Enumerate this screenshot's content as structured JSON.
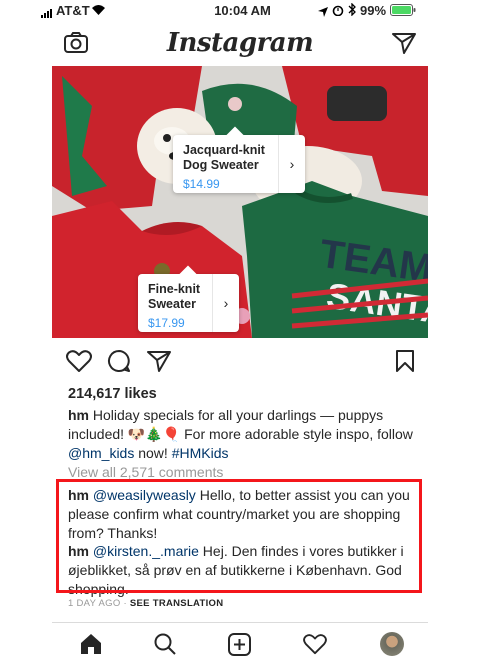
{
  "status_bar": {
    "carrier": "AT&T",
    "time": "10:04 AM",
    "battery": "99%"
  },
  "header": {
    "logo": "Instagram"
  },
  "product_tags": [
    {
      "name_line1": "Jacquard-knit",
      "name_line2": "Dog Sweater",
      "price": "$14.99"
    },
    {
      "name_line1": "Fine-knit",
      "name_line2": "Sweater",
      "price": "$17.99"
    }
  ],
  "photo": {
    "sweater_text_1": "TEAM",
    "sweater_text_2": "SANTA"
  },
  "post": {
    "likes": "214,617 likes",
    "caption_user": "hm",
    "caption_text": "Holiday specials for all your darlings — puppys included! 🐶🎄🎈 For more adorable style inspo, follow",
    "caption_mention": "@hm_kids",
    "caption_middle": " now! ",
    "caption_hashtag": "#HMKids",
    "view_all": "View all 2,571 comments",
    "comments": [
      {
        "user": "hm",
        "mention": "@weasilyweasly",
        "text": " Hello, to better assist you can you please confirm what country/market you are shopping from? Thanks!"
      },
      {
        "user": "hm",
        "mention": "@kirsten._.marie",
        "text": " Hej. Den findes i vores butikker i øjeblikket, så prøv en af butikkerne i København. God shopping."
      }
    ],
    "time_ago": "1 DAY AGO",
    "see_translation": "SEE TRANSLATION"
  },
  "colors": {
    "accent_blue": "#3897f0",
    "link": "#003569",
    "highlight_red": "#f4161b"
  }
}
